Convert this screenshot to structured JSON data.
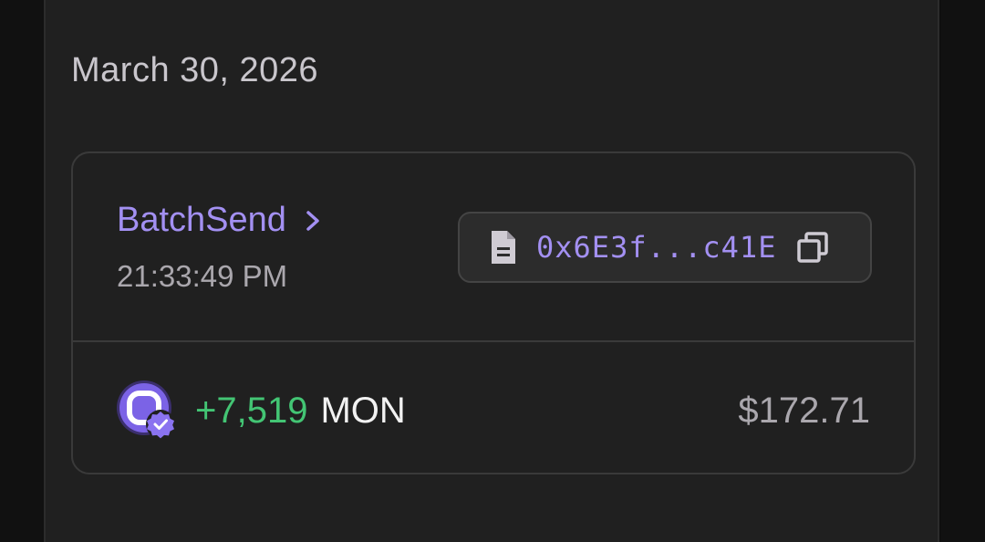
{
  "date_heading": "March 30, 2026",
  "transaction": {
    "type_label": "BatchSend",
    "time": "21:33:49 PM",
    "hash_short": "0x6E3f...c41E",
    "token": {
      "amount": "+7,519",
      "symbol": "MON",
      "usd_value": "$172.71"
    }
  },
  "icons": {
    "chevron": "chevron-right-icon",
    "document": "document-icon",
    "copy": "copy-icon",
    "token": "monad-token-icon",
    "verified": "verified-badge-icon"
  },
  "colors": {
    "accent": "#a390f2",
    "positive": "#43c574",
    "background": "#202020",
    "muted_text": "#aaa7ad"
  }
}
